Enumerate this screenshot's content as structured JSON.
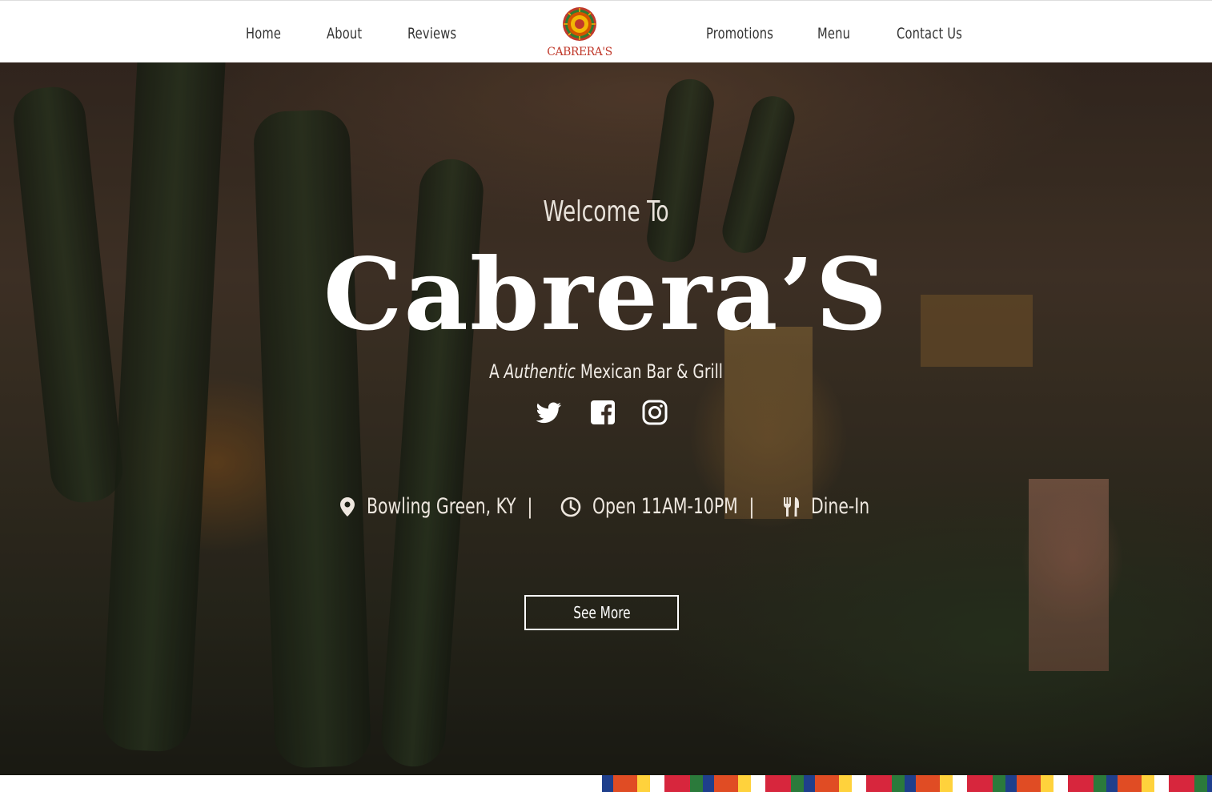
{
  "nav": {
    "left_links": [
      "Home",
      "About",
      "Reviews"
    ],
    "right_links": [
      "Promotions",
      "Menu",
      "Contact Us"
    ],
    "logo_text": "CABRERA'S"
  },
  "hero": {
    "welcome": "Welcome To",
    "brand": "Cabrera’S",
    "tagline_prefix": "A",
    "tagline_emphasis": "Authentic",
    "tagline_suffix": "Mexican Bar & Grill",
    "social": [
      "twitter-icon",
      "facebook-icon",
      "instagram-icon"
    ],
    "info": {
      "location": "Bowling Green, KY",
      "hours": "Open 11AM-10PM",
      "service": "Dine-In",
      "separator": "|"
    },
    "cta": "See More"
  },
  "colors": {
    "nav_bg": "#ffffff",
    "nav_text": "#333333",
    "logo_red": "#c0392b",
    "logo_green": "#2e7d32",
    "logo_yellow": "#f2b705",
    "hero_text": "#ffffff"
  }
}
